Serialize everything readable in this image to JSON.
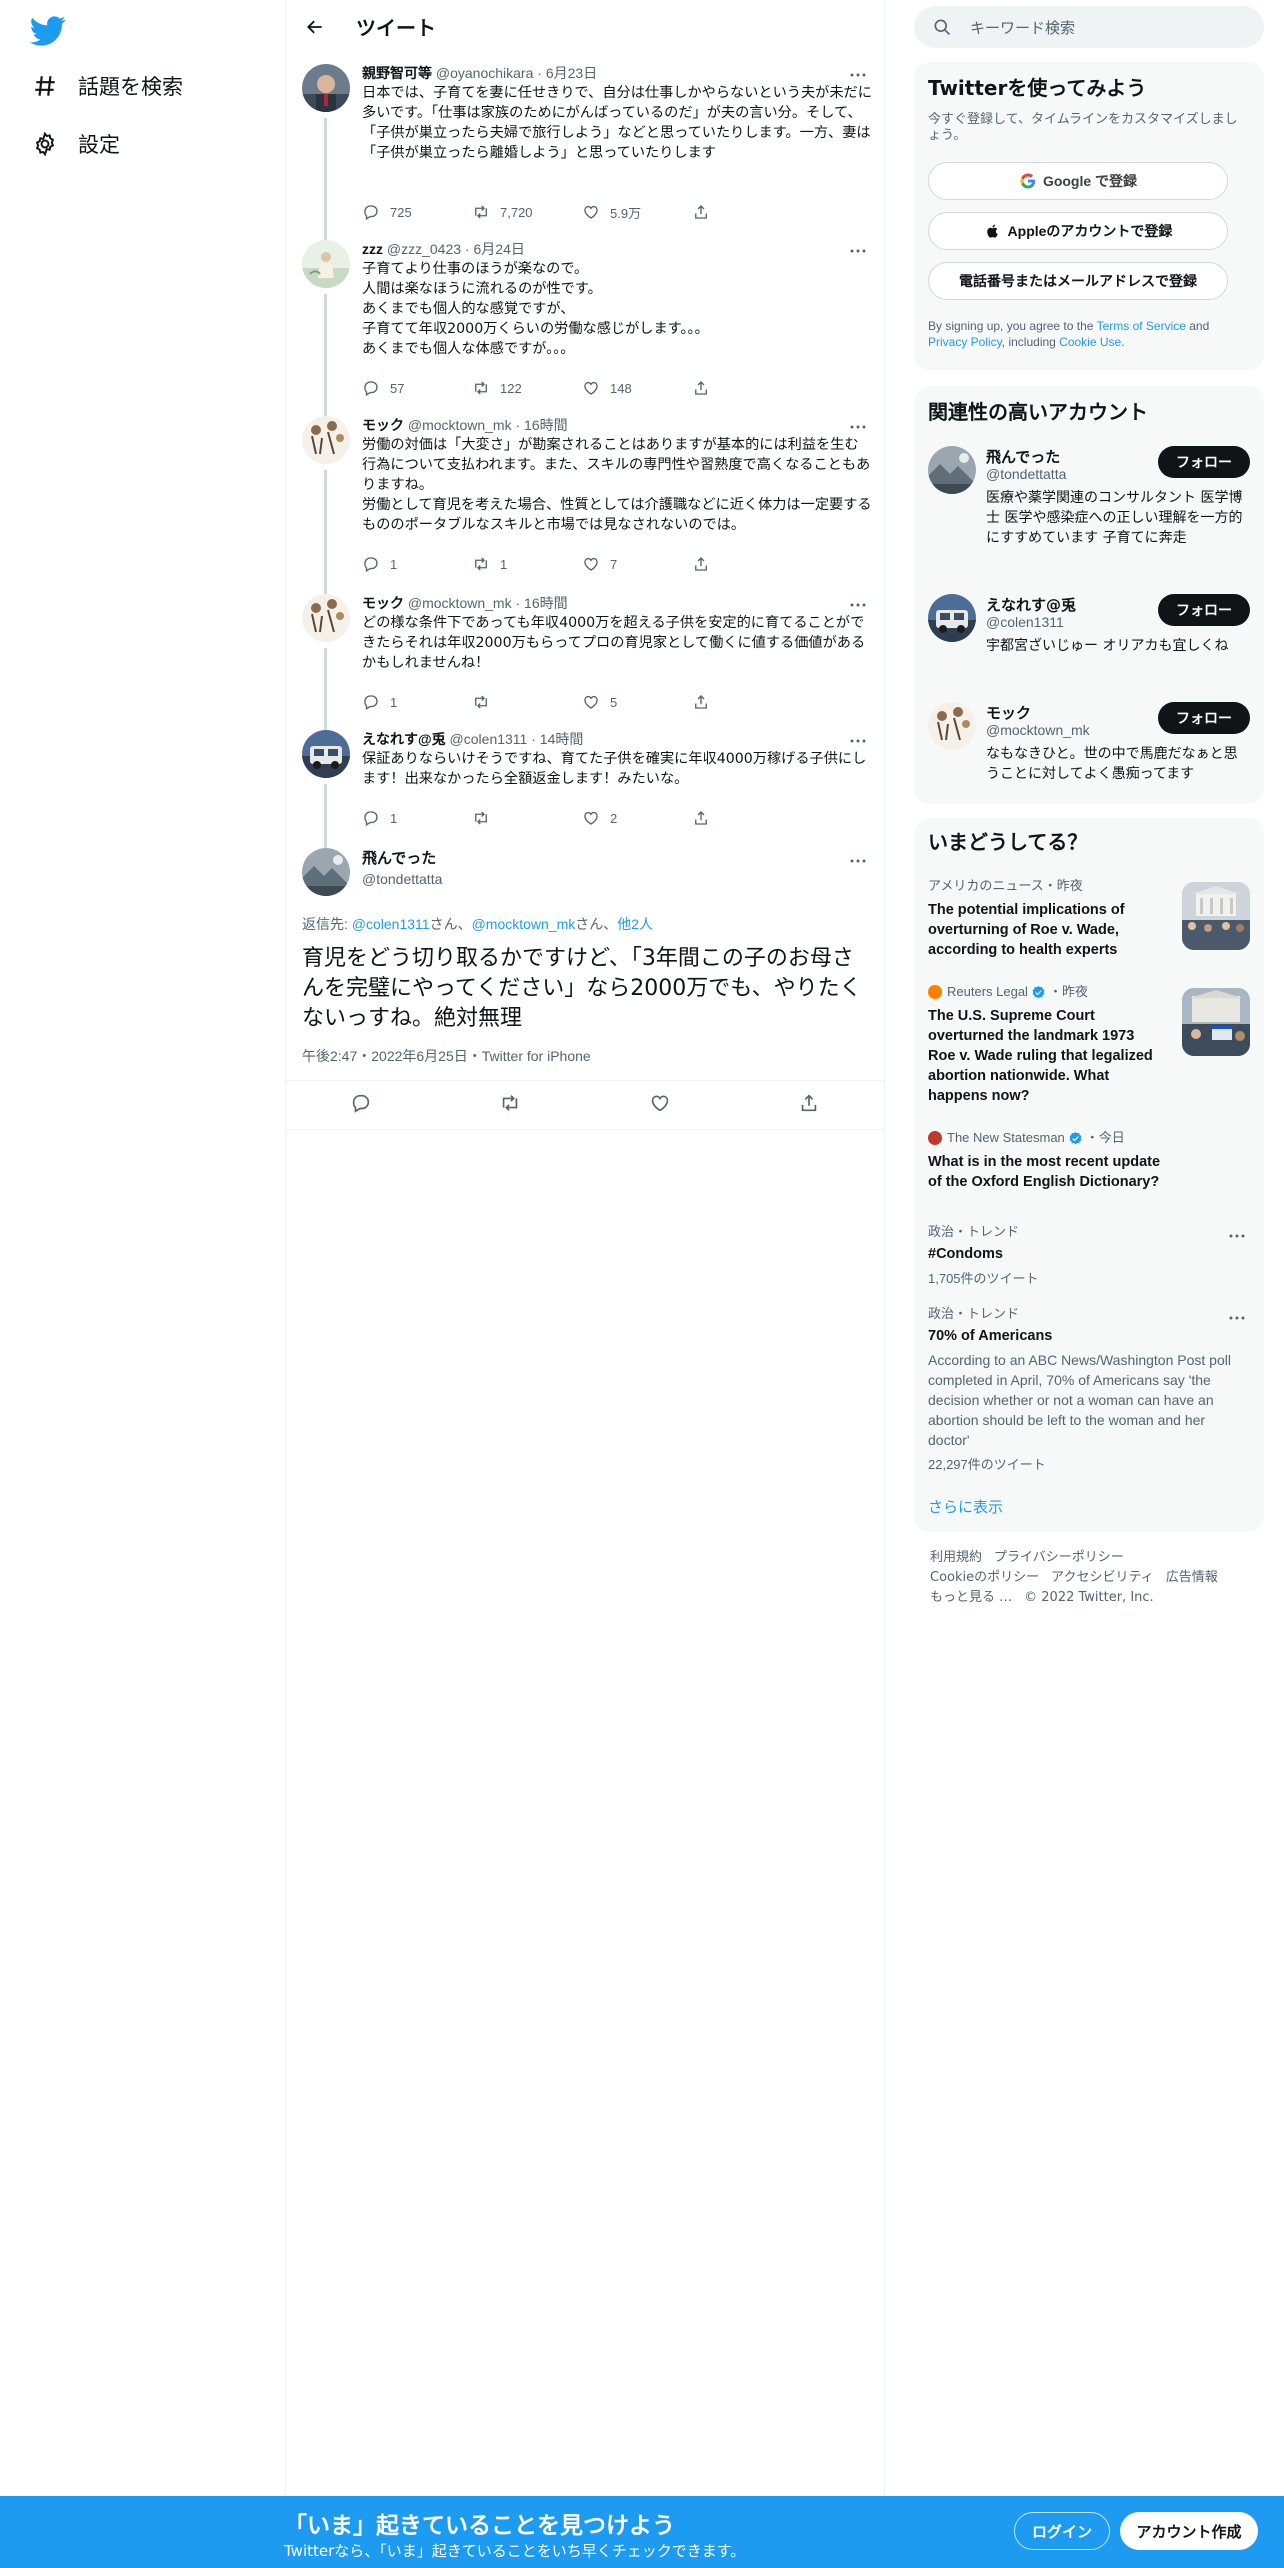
{
  "nav": {
    "items": [
      {
        "label": "話題を検索",
        "icon": "hashtag-icon"
      },
      {
        "label": "設定",
        "icon": "gear-icon"
      }
    ]
  },
  "header": {
    "title": "ツイート"
  },
  "tweets": [
    {
      "name": "親野智可等",
      "handle": "@oyanochikara",
      "time": "6月23日",
      "text": "日本では、子育てを妻に任せきりで、自分は仕事しかやらないという夫が未だに多いです。「仕事は家族のためにがんばっているのだ」が夫の言い分。そして、「子供が巣立ったら夫婦で旅行しよう」などと思っていたりします。一方、妻は「子供が巣立ったら離婚しよう」と思っていたりします",
      "replies": "725",
      "retweets": "7,720",
      "likes": "5.9万"
    },
    {
      "name": "zzz",
      "handle": "@zzz_0423",
      "time": "6月24日",
      "text": "子育てより仕事のほうが楽なので。\n人間は楽なほうに流れるのが性です。\nあくまでも個人的な感覚ですが、\n子育てて年収2000万くらいの労働な感じがします。。。\nあくまでも個人な体感ですが。。。",
      "replies": "57",
      "retweets": "122",
      "likes": "148"
    },
    {
      "name": "モック",
      "handle": "@mocktown_mk",
      "time": "16時間",
      "text": "労働の対価は「大変さ」が勘案されることはありますが基本的には利益を生む行為について支払われます。また、スキルの専門性や習熟度で高くなることもありますね。\n労働として育児を考えた場合、性質としては介護職などに近く体力は一定要するもののポータブルなスキルと市場では見なされないのでは。",
      "replies": "1",
      "retweets": "1",
      "likes": "7"
    },
    {
      "name": "モック",
      "handle": "@mocktown_mk",
      "time": "16時間",
      "text": "どの様な条件下であっても年収4000万を超える子供を安定的に育てることができたらそれは年収2000万もらってプロの育児家として働くに値する価値があるかもしれませんね！",
      "replies": "1",
      "retweets": "",
      "likes": "5"
    },
    {
      "name": "えなれす@兎",
      "handle": "@colen1311",
      "time": "14時間",
      "text": "保証ありならいけそうですね、育てた子供を確実に年収4000万稼げる子供にします！出来なかったら全額返金します！みたいな。",
      "replies": "1",
      "retweets": "",
      "likes": "2"
    }
  ],
  "focus": {
    "name": "飛んでった",
    "handle": "@tondettatta",
    "reply_prefix": "返信先: ",
    "reply_user1": "@colen1311",
    "reply_sep1": "さん、",
    "reply_user2": "@mocktown_mk",
    "reply_sep2": "さん、",
    "reply_others": "他2人",
    "text": "育児をどう切り取るかですけど、「3年間この子のお母さんを完璧にやってください」なら2000万でも、やりたくないっすね。絶対無理",
    "meta": "午後2:47・2022年6月25日・Twitter for iPhone"
  },
  "search": {
    "placeholder": "キーワード検索"
  },
  "join": {
    "title": "Twitterを使ってみよう",
    "subtitle": "今すぐ登録して、タイムラインをカスタマイズしましょう。",
    "google": "Google で登録",
    "apple": "Appleのアカウントで登録",
    "phone": "電話番号またはメールアドレスで登録",
    "terms_1": "By signing up, you agree to the ",
    "terms_link1": "Terms of Service",
    "terms_2": " and ",
    "terms_link2": "Privacy Policy",
    "terms_3": ", including ",
    "terms_link3": "Cookie Use",
    "terms_4": "."
  },
  "related": {
    "title": "関連性の高いアカウント",
    "follow_label": "フォロー",
    "accounts": [
      {
        "name": "飛んでった",
        "handle": "@tondettatta",
        "bio": "医療や薬学関連のコンサルタント 医学博士 医学や感染症への正しい理解を一方的にすすめています 子育てに奔走"
      },
      {
        "name": "えなれす@兎",
        "handle": "@colen1311",
        "bio": "宇都宮ざいじゅー オリアカも宜しくね"
      },
      {
        "name": "モック",
        "handle": "@mocktown_mk",
        "bio": "なもなきひと。世の中で馬鹿だなぁと思うことに対してよく愚痴ってます"
      }
    ]
  },
  "trends": {
    "title": "いまどうしてる？",
    "items": [
      {
        "meta": "アメリカのニュース・昨夜",
        "title": "The potential implications of overturning of Roe v. Wade, according to health experts"
      },
      {
        "source": "Reuters Legal",
        "meta": "・昨夜",
        "title": "The U.S. Supreme Court overturned the landmark 1973 Roe v. Wade ruling that legalized abortion nationwide. What happens now?"
      },
      {
        "source": "The New Statesman",
        "meta": "・今日",
        "title": "What is in the most recent update of the Oxford English Dictionary?"
      },
      {
        "meta": "政治・トレンド",
        "title": "#Condoms",
        "count": "1,705件のツイート"
      },
      {
        "meta": "政治・トレンド",
        "title": "70% of Americans",
        "desc": "According to an ABC News/Washington Post poll completed in April, 70% of Americans say 'the decision whether or not a woman can have an abortion should be left to the woman and her doctor'",
        "count": "22,297件のツイート"
      }
    ],
    "show_more": "さらに表示"
  },
  "footer": {
    "links1": [
      "利用規約",
      "プライバシーポリシー"
    ],
    "links2": [
      "Cookieのポリシー",
      "アクセシビリティ",
      "広告情報"
    ],
    "more": "もっと見る …",
    "copyright": "© 2022 Twitter, Inc."
  },
  "bottombar": {
    "title": "「いま」起きていることを見つけよう",
    "subtitle": "Twitterなら、「いま」起きていることをいち早くチェックできます。",
    "login": "ログイン",
    "signup": "アカウント作成"
  },
  "colors": {
    "accent": "#1d9bf0",
    "text": "#0f1419",
    "secondary": "#536471"
  }
}
